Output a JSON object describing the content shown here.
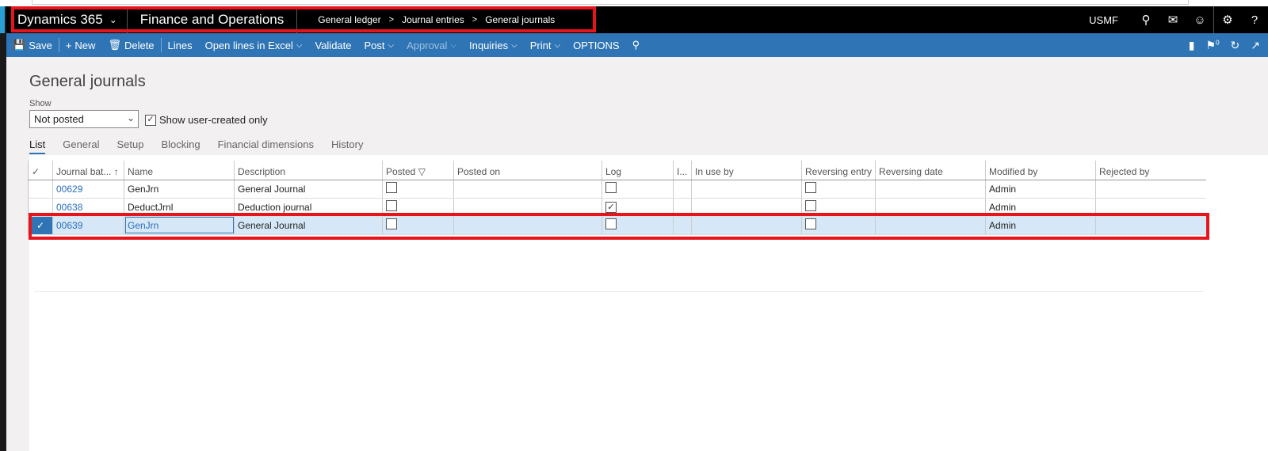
{
  "nav": {
    "brand": "Dynamics 365",
    "app": "Finance and Operations",
    "breadcrumb": [
      "General ledger",
      "Journal entries",
      "General journals"
    ],
    "company": "USMF"
  },
  "actions": {
    "save": "Save",
    "new": "New",
    "delete": "Delete",
    "lines": "Lines",
    "excel": "Open lines in Excel",
    "validate": "Validate",
    "post": "Post",
    "approval": "Approval",
    "inquiries": "Inquiries",
    "print": "Print",
    "options": "OPTIONS",
    "notification_count": "0"
  },
  "page": {
    "title": "General journals",
    "show_label": "Show",
    "show_value": "Not posted",
    "user_created_label": "Show user-created only",
    "user_created_checked": true
  },
  "tabs": [
    "List",
    "General",
    "Setup",
    "Blocking",
    "Financial dimensions",
    "History"
  ],
  "grid": {
    "columns": [
      "Journal bat...",
      "Name",
      "Description",
      "Posted",
      "Posted on",
      "Log",
      "I...",
      "In use by",
      "Reversing entry",
      "Reversing date",
      "Modified by",
      "Rejected by"
    ],
    "rows": [
      {
        "batch": "00629",
        "name": "GenJrn",
        "description": "General Journal",
        "posted": false,
        "log": false,
        "reversing": false,
        "modified_by": "Admin",
        "selected": false
      },
      {
        "batch": "00638",
        "name": "DeductJrnl",
        "description": "Deduction journal",
        "posted": false,
        "log": true,
        "reversing": false,
        "modified_by": "Admin",
        "selected": false
      },
      {
        "batch": "00639",
        "name": "GenJrn",
        "description": "General Journal",
        "posted": false,
        "log": false,
        "reversing": false,
        "modified_by": "Admin",
        "selected": true
      }
    ]
  }
}
